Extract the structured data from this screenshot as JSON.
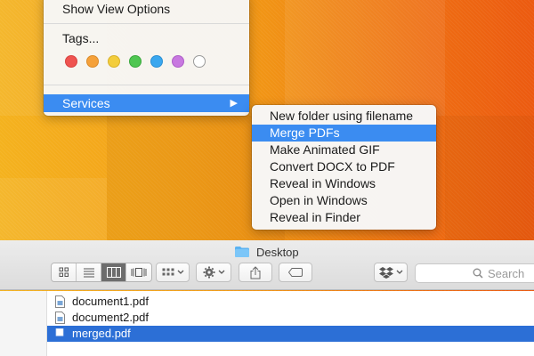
{
  "context_menu": {
    "show_view_options": "Show View Options",
    "tags_label": "Tags...",
    "tag_colors": [
      "#ef5350",
      "#f5a13a",
      "#f3cd3c",
      "#4fc651",
      "#3aa7ef",
      "#c878e0",
      "#ffffff"
    ],
    "services_label": "Services",
    "submenu_arrow": "▶"
  },
  "services_menu": {
    "items": [
      "New folder using filename",
      "Merge PDFs",
      "Make Animated GIF",
      "Convert DOCX to PDF",
      "Reveal in Windows",
      "Open in Windows",
      "Reveal in Finder"
    ],
    "highlighted_index": 1
  },
  "finder": {
    "title": "Desktop",
    "search_placeholder": "Search",
    "files": [
      "document1.pdf",
      "document2.pdf",
      "merged.pdf"
    ],
    "selected_index": 2
  },
  "colors": {
    "highlight": "#3b8cf1",
    "selection": "#2c6fd6"
  }
}
